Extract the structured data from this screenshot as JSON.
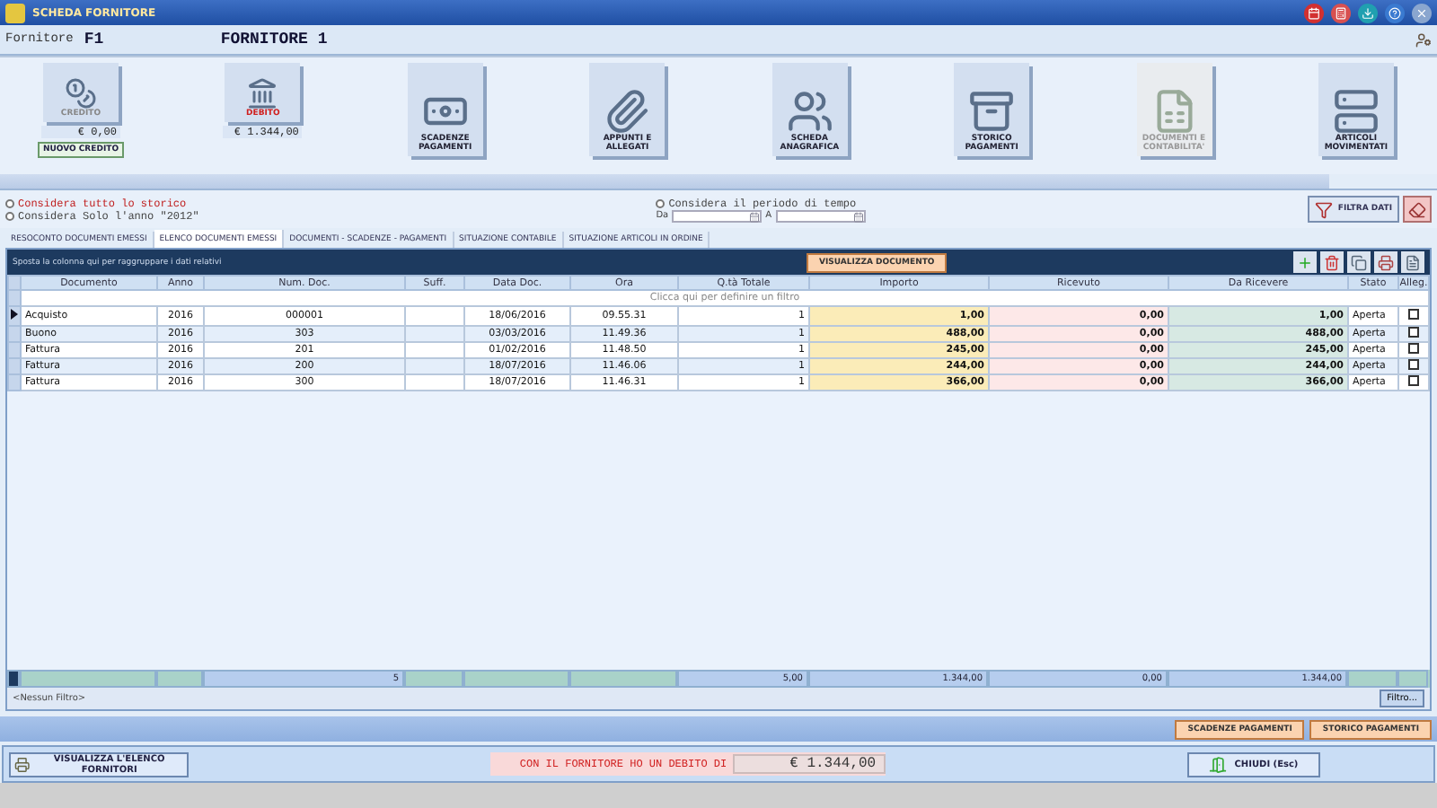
{
  "window": {
    "title": "SCHEDA FORNITORE"
  },
  "supplier": {
    "label": "Fornitore",
    "code": "F1",
    "name": "FORNITORE 1"
  },
  "actions": [
    {
      "kind": "credit",
      "label": "CREDITO",
      "amount": "€ 0,00",
      "button": "NUOVO CREDITO",
      "disabled": false
    },
    {
      "kind": "debit",
      "label": "DEBITO",
      "amount": "€ 1.344,00",
      "disabled": false
    },
    {
      "kind": "money",
      "label": "SCADENZE PAGAMENTI",
      "disabled": false
    },
    {
      "kind": "clip",
      "label": "APPUNTI E ALLEGATI",
      "disabled": false
    },
    {
      "kind": "people",
      "label": "SCHEDA ANAGRAFICA",
      "disabled": false
    },
    {
      "kind": "safe",
      "label": "STORICO PAGAMENTI",
      "disabled": false
    },
    {
      "kind": "doc",
      "label": "DOCUMENTI E CONTABILITA'",
      "disabled": true
    },
    {
      "kind": "cabinet",
      "label": "ARTICOLI MOVIMENTATI",
      "disabled": false
    }
  ],
  "period": {
    "options": [
      {
        "label": "Considera tutto lo storico",
        "selected": false
      },
      {
        "label": "Considera il periodo di tempo",
        "selected": false
      },
      {
        "label": "Considera Solo l'anno \"2012\"",
        "selected": false
      }
    ],
    "from_label": "Da",
    "to_label": "A",
    "filter_button": "FILTRA DATI"
  },
  "tabs": [
    {
      "label": "RESOCONTO DOCUMENTI EMESSI",
      "selected": false
    },
    {
      "label": "ELENCO DOCUMENTI EMESSI",
      "selected": true
    },
    {
      "label": "DOCUMENTI - SCADENZE - PAGAMENTI",
      "selected": false
    },
    {
      "label": "SITUAZIONE CONTABILE",
      "selected": false
    },
    {
      "label": "SITUAZIONE ARTICOLI IN ORDINE",
      "selected": false
    }
  ],
  "grid": {
    "group_hint": "Sposta la colonna qui per raggruppare i dati relativi",
    "view_button": "VISUALIZZA DOCUMENTO",
    "filter_hint": "Clicca qui per definire un filtro",
    "columns": [
      {
        "label": "Documento"
      },
      {
        "label": "Anno"
      },
      {
        "label": "Num. Doc.",
        "total": "5"
      },
      {
        "label": "Suff."
      },
      {
        "label": "Data Doc."
      },
      {
        "label": "Ora"
      },
      {
        "label": "Q.tà Totale",
        "total": "5,00"
      },
      {
        "label": "Importo",
        "total": "1.344,00"
      },
      {
        "label": "Ricevuto",
        "total": "0,00"
      },
      {
        "label": "Da Ricevere",
        "total": "1.344,00"
      },
      {
        "label": "Stato"
      },
      {
        "label": "Alleg."
      }
    ],
    "rows": [
      {
        "current": true,
        "document": "Acquisto",
        "year": "2016",
        "number": "000001",
        "date": "18/06/2016",
        "time": "09.55.31",
        "qty": "1",
        "amount": "1,00",
        "received": "0,00",
        "to_receive": "1,00",
        "status": "Aperta",
        "attached": false
      },
      {
        "current": false,
        "document": "Buono",
        "year": "2016",
        "number": "303",
        "date": "03/03/2016",
        "time": "11.49.36",
        "qty": "1",
        "amount": "488,00",
        "received": "0,00",
        "to_receive": "488,00",
        "status": "Aperta",
        "attached": false
      },
      {
        "current": false,
        "document": "Fattura",
        "year": "2016",
        "number": "201",
        "date": "01/02/2016",
        "time": "11.48.50",
        "qty": "1",
        "amount": "245,00",
        "received": "0,00",
        "to_receive": "245,00",
        "status": "Aperta",
        "attached": false
      },
      {
        "current": false,
        "document": "Fattura",
        "year": "2016",
        "number": "200",
        "date": "18/07/2016",
        "time": "11.46.06",
        "qty": "1",
        "amount": "244,00",
        "received": "0,00",
        "to_receive": "244,00",
        "status": "Aperta",
        "attached": false
      },
      {
        "current": false,
        "document": "Fattura",
        "year": "2016",
        "number": "300",
        "date": "18/07/2016",
        "time": "11.46.31",
        "qty": "1",
        "amount": "366,00",
        "received": "0,00",
        "to_receive": "366,00",
        "status": "Aperta",
        "attached": false
      }
    ],
    "filter_status": "<Nessun Filtro>",
    "filter_button": "Filtro..."
  },
  "bottom_buttons": [
    "SCADENZE PAGAMENTI",
    "STORICO PAGAMENTI"
  ],
  "footer": {
    "list_button": "VISUALIZZA L'ELENCO FORNITORI",
    "message": "CON IL FORNITORE HO UN DEBITO DI",
    "amount": "€ 1.344,00",
    "close_button": "CHIUDI (Esc)"
  }
}
